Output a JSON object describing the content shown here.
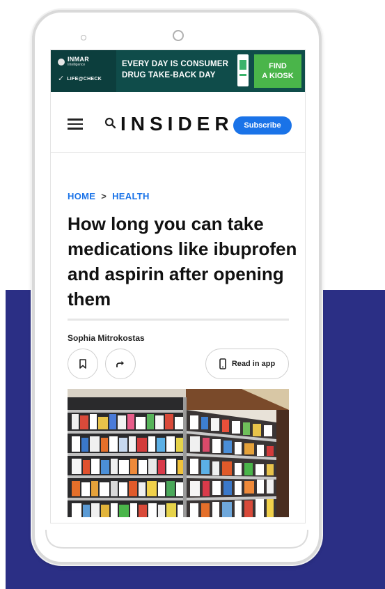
{
  "ad": {
    "brand_top": "INMAR",
    "brand_top_sub": "Intelligence",
    "brand_bottom": "LIFE@CHECK",
    "headline_line1": "EVERY DAY IS CONSUMER",
    "headline_line2": "DRUG TAKE-BACK DAY",
    "cta": "FIND\nA KIOSK",
    "colors": {
      "background": "#0f4c4a",
      "cta": "#4ab54a"
    }
  },
  "header": {
    "logo": "INSIDER",
    "subscribe_label": "Subscribe",
    "accent": "#1a73e8"
  },
  "breadcrumb": {
    "home": "HOME",
    "separator": ">",
    "section": "HEALTH"
  },
  "article": {
    "headline": "How long you can take medications like ibuprofen and aspirin after opening them",
    "author": "Sophia Mitrokostas",
    "read_in_app_label": "Read in app"
  },
  "icons": [
    "hamburger-menu-icon",
    "search-icon",
    "bookmark-icon",
    "share-icon",
    "phone-icon"
  ],
  "background": {
    "band_color": "#2b2f85"
  }
}
